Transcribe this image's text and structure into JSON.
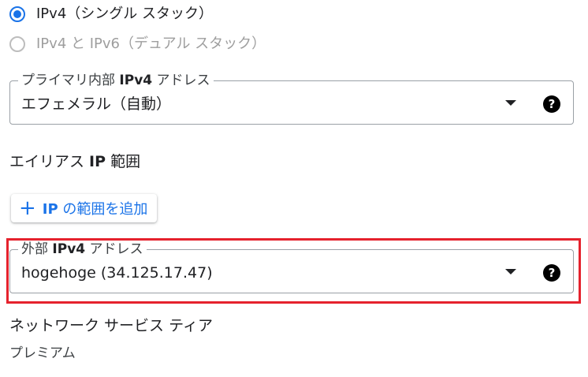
{
  "ip_stack": {
    "options": [
      {
        "label": "IPv4（シングル スタック）",
        "selected": true,
        "enabled": true
      },
      {
        "label": "IPv4 と IPv6（デュアル スタック）",
        "selected": false,
        "enabled": false
      }
    ]
  },
  "primary_internal_ipv4": {
    "legend_prefix": "プライマリ内部 ",
    "legend_bold": "IPv4",
    "legend_suffix": " アドレス",
    "value": "エフェメラル（自動）"
  },
  "alias_ip": {
    "heading_prefix": "エイリアス ",
    "heading_bold": "IP",
    "heading_suffix": " 範囲",
    "add_button_bold": "IP",
    "add_button_rest": " の範囲を追加",
    "add_icon": "plus-icon"
  },
  "external_ipv4": {
    "legend_prefix": "外部 ",
    "legend_bold": "IPv4",
    "legend_suffix": " アドレス",
    "value": "hogehoge (34.125.17.47)"
  },
  "network_tier": {
    "heading": "ネットワーク サービス ティア",
    "value": "プレミアム"
  },
  "colors": {
    "accent": "#1a73e8",
    "highlight_border": "#e5222d"
  },
  "icons": {
    "dropdown": "dropdown-arrow-icon",
    "help": "help-icon",
    "help_glyph": "?"
  }
}
